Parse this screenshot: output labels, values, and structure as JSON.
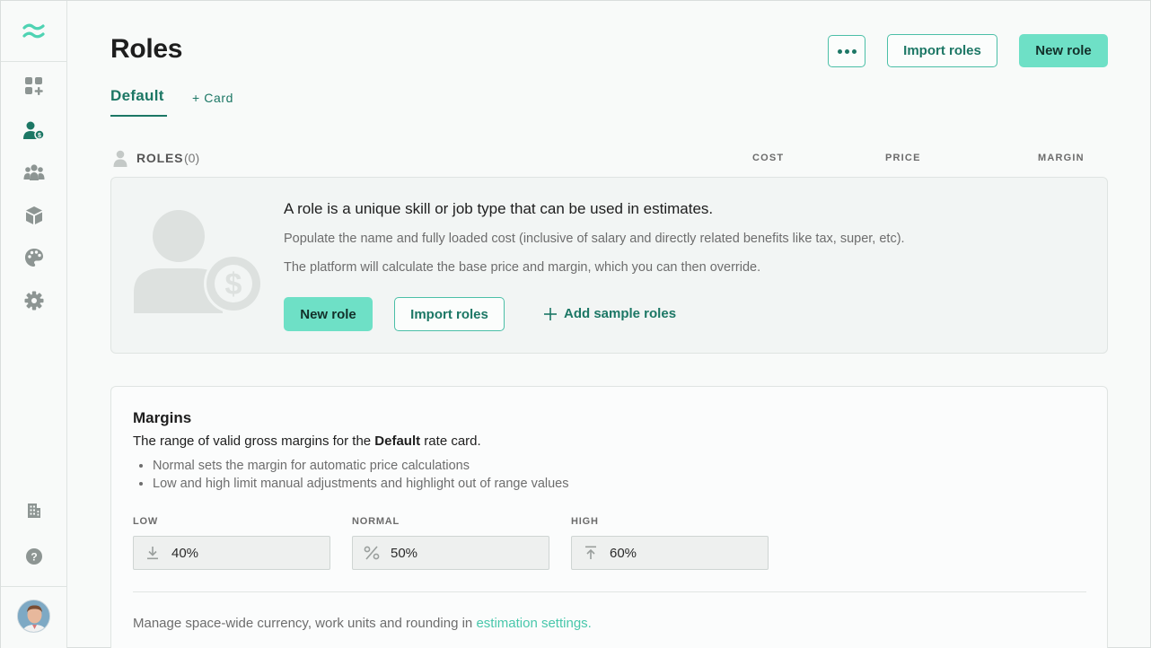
{
  "colors": {
    "accent": "#1c7765",
    "accent_light": "#6ee0c6",
    "link": "#48c7ab"
  },
  "sidebar": {
    "logo_icon": "wave-logo-icon",
    "items": [
      {
        "icon": "apps-add-icon"
      },
      {
        "icon": "role-cost-icon",
        "active": true
      },
      {
        "icon": "team-icon"
      },
      {
        "icon": "package-icon"
      },
      {
        "icon": "palette-icon"
      },
      {
        "icon": "gear-icon"
      }
    ],
    "bottom_items": [
      {
        "icon": "building-icon"
      },
      {
        "icon": "help-icon"
      }
    ],
    "avatar": "user-avatar"
  },
  "header": {
    "title": "Roles",
    "more_icon": "more-icon",
    "import_label": "Import roles",
    "new_label": "New role"
  },
  "tabs": {
    "default_label": "Default",
    "card_label": "+ Card"
  },
  "roles_list": {
    "label": "ROLES",
    "count": "(0)",
    "columns": {
      "cost": "COST",
      "price": "PRICE",
      "margin": "MARGIN"
    }
  },
  "empty_state": {
    "heading": "A role is a unique skill or job type that can be used in estimates.",
    "p1": "Populate the name and fully loaded cost (inclusive of salary and directly related benefits like tax, super, etc).",
    "p2": "The platform will calculate the base price and margin, which you can then override.",
    "new_label": "New role",
    "import_label": "Import roles",
    "sample_label": "Add sample roles"
  },
  "margins": {
    "title": "Margins",
    "desc_pre": "The range of valid gross margins for the ",
    "desc_bold": "Default",
    "desc_post": " rate card.",
    "bullets": [
      "Normal sets the margin for automatic price calculations",
      "Low and high limit manual adjustments and highlight out of range values"
    ],
    "low_label": "LOW",
    "low_value": "40%",
    "normal_label": "NORMAL",
    "normal_value": "50%",
    "high_label": "HIGH",
    "high_value": "60%",
    "footer_pre": "Manage space-wide currency, work units and rounding in ",
    "footer_link": "estimation settings."
  }
}
